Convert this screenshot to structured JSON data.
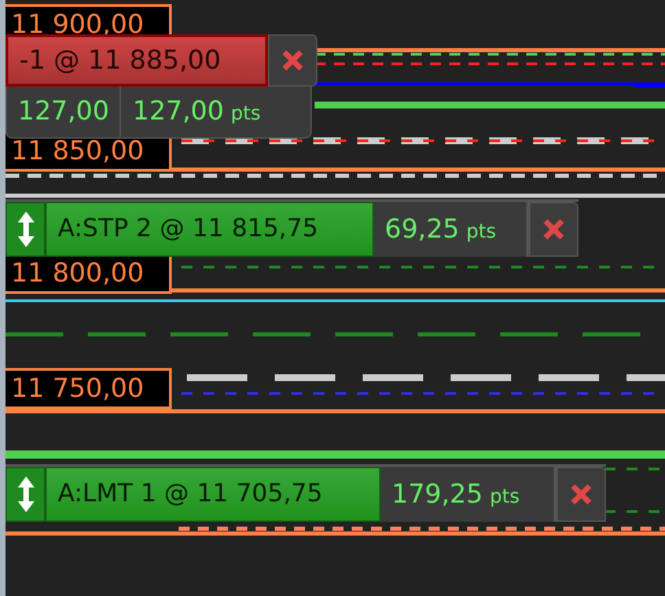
{
  "price_labels": [
    "11 900,00",
    "11 850,00",
    "11 800,00",
    "11 750,00"
  ],
  "orders": [
    {
      "kind": "position",
      "label": "-1 @ 11 885,00",
      "values": [
        {
          "value": "127,00"
        },
        {
          "value": "127,00",
          "unit": "pts"
        }
      ]
    },
    {
      "kind": "order",
      "label": "A:STP  2 @ 11 815,75",
      "value": "69,25",
      "unit": "pts"
    },
    {
      "kind": "order",
      "label": "A:LMT  1 @ 11 705,75",
      "value": "179,25",
      "unit": "pts"
    }
  ]
}
